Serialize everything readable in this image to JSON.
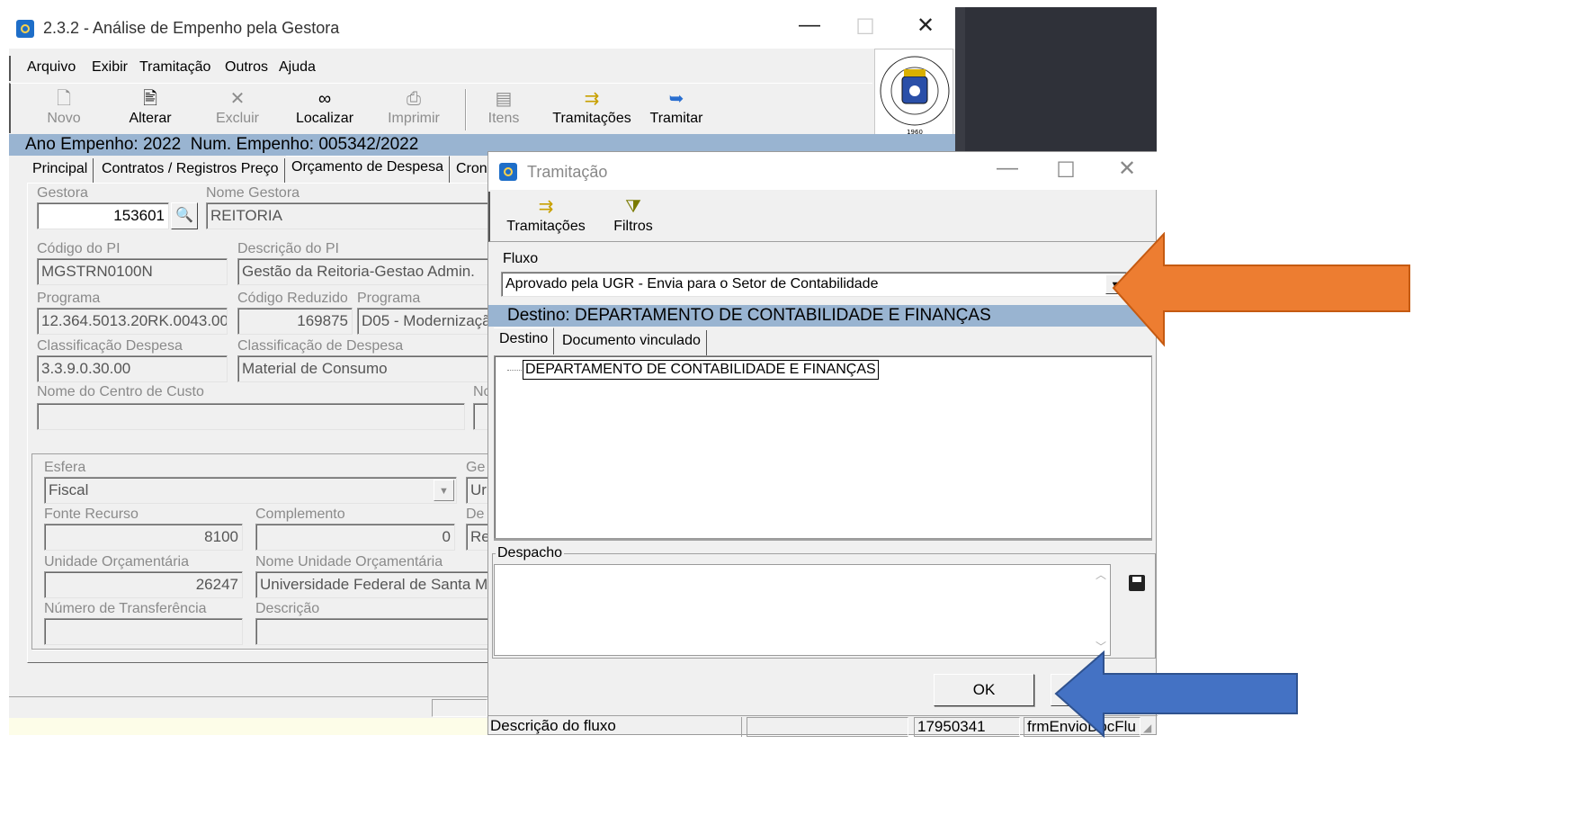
{
  "main_window": {
    "title": "2.3.2 - Análise de Empenho pela Gestora",
    "menu": [
      "Arquivo",
      "Exibir",
      "Tramitação",
      "Outros",
      "Ajuda"
    ],
    "toolbar": [
      {
        "label": "Novo",
        "icon": "new-document-icon",
        "enabled": false
      },
      {
        "label": "Alterar",
        "icon": "edit-document-icon",
        "enabled": true
      },
      {
        "label": "Excluir",
        "icon": "delete-x-icon",
        "enabled": false
      },
      {
        "label": "Localizar",
        "icon": "binoculars-icon",
        "enabled": true
      },
      {
        "label": "Imprimir",
        "icon": "printer-icon",
        "enabled": false
      },
      {
        "label": "Itens",
        "icon": "items-icon",
        "enabled": false
      },
      {
        "label": "Tramitações",
        "icon": "routing-icon",
        "enabled": true
      },
      {
        "label": "Tramitar",
        "icon": "send-icon",
        "enabled": true
      }
    ],
    "header_bar": "Ano Empenho: 2022  Num. Empenho: 005342/2022",
    "tabs": [
      "Principal",
      "Contratos / Registros Preço",
      "Orçamento de Despesa",
      "Cron"
    ],
    "fields": {
      "gestora_label": "Gestora",
      "gestora_value": "153601",
      "nome_gestora_label": "Nome Gestora",
      "nome_gestora_value": "REITORIA",
      "codigo_pi_label": "Código do PI",
      "codigo_pi_value": "MGSTRN0100N",
      "descricao_pi_label": "Descrição do PI",
      "descricao_pi_value": "Gestão da Reitoria-Gestao Admin.",
      "programa_label": "Programa",
      "programa_value": "12.364.5013.20RK.0043.00",
      "codigo_reduzido_label": "Código Reduzido",
      "codigo_reduzido_value": "169875",
      "programa2_label": "Programa",
      "programa2_value": "D05 - Modernizaçã",
      "classificacao_label": "Classificação Despesa",
      "classificacao_value": "3.3.9.0.30.00",
      "classificacao_desc_label": "Classificação de Despesa",
      "classificacao_desc_value": "Material de Consumo",
      "centro_custo_label": "Nome do Centro de Custo",
      "centro_custo_value": "",
      "nc_label": "Nc",
      "esfera_label": "Esfera",
      "esfera_value": "Fiscal",
      "ge_label": "Ge",
      "ge_value": "Ur",
      "fonte_label": "Fonte Recurso",
      "fonte_value": "8100",
      "complemento_label": "Complemento",
      "complemento_value": "0",
      "de_label": "De",
      "de_value": "Re",
      "unidade_label": "Unidade Orçamentária",
      "unidade_value": "26247",
      "nome_unidade_label": "Nome Unidade Orçamentária",
      "nome_unidade_value": "Universidade Federal de Santa Maria",
      "num_transf_label": "Número de Transferência",
      "num_transf_value": "",
      "descricao_label": "Descrição",
      "descricao_value": ""
    }
  },
  "dialog": {
    "title": "Tramitação",
    "toolbar": [
      {
        "label": "Tramitações",
        "icon": "routing-icon"
      },
      {
        "label": "Filtros",
        "icon": "filter-icon"
      }
    ],
    "fluxo_label": "Fluxo",
    "fluxo_value": "Aprovado pela UGR - Envia para o Setor de Contabilidade",
    "destino_bar": "Destino: DEPARTAMENTO DE CONTABILIDADE E FINANÇAS",
    "tabs": [
      "Destino",
      "Documento vinculado"
    ],
    "tree_item": "DEPARTAMENTO DE CONTABILIDADE E FINANÇAS",
    "despacho_label": "Despacho",
    "despacho_value": "",
    "ok_label": "OK",
    "status": [
      "Descrição do fluxo",
      "",
      "17950341",
      "frmEnvioDocFlu"
    ]
  },
  "colors": {
    "header_bar": "#99b4d1",
    "orange_arrow": "#ed7d31",
    "blue_arrow": "#4472c4",
    "desktop_bg": "#2e3038"
  }
}
